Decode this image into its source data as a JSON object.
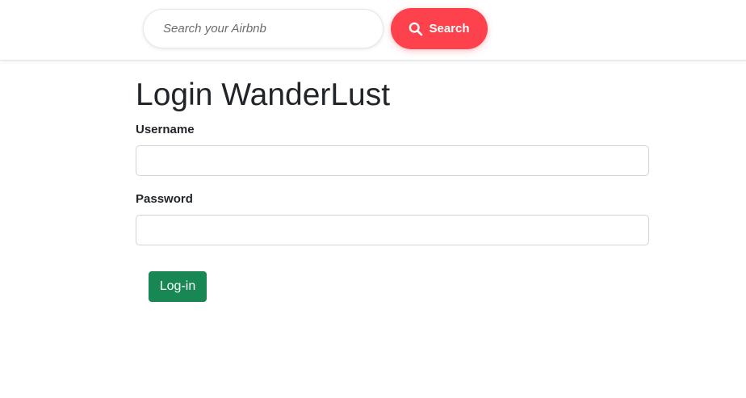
{
  "header": {
    "search": {
      "placeholder": "Search your Airbnb",
      "value": ""
    },
    "search_button": {
      "label": "Search",
      "icon": "search-icon",
      "color": "#fe424d"
    }
  },
  "main": {
    "title": "Login WanderLust",
    "username": {
      "label": "Username",
      "value": ""
    },
    "password": {
      "label": "Password",
      "value": ""
    },
    "login_button": {
      "label": "Log-in",
      "color": "#198754"
    }
  }
}
